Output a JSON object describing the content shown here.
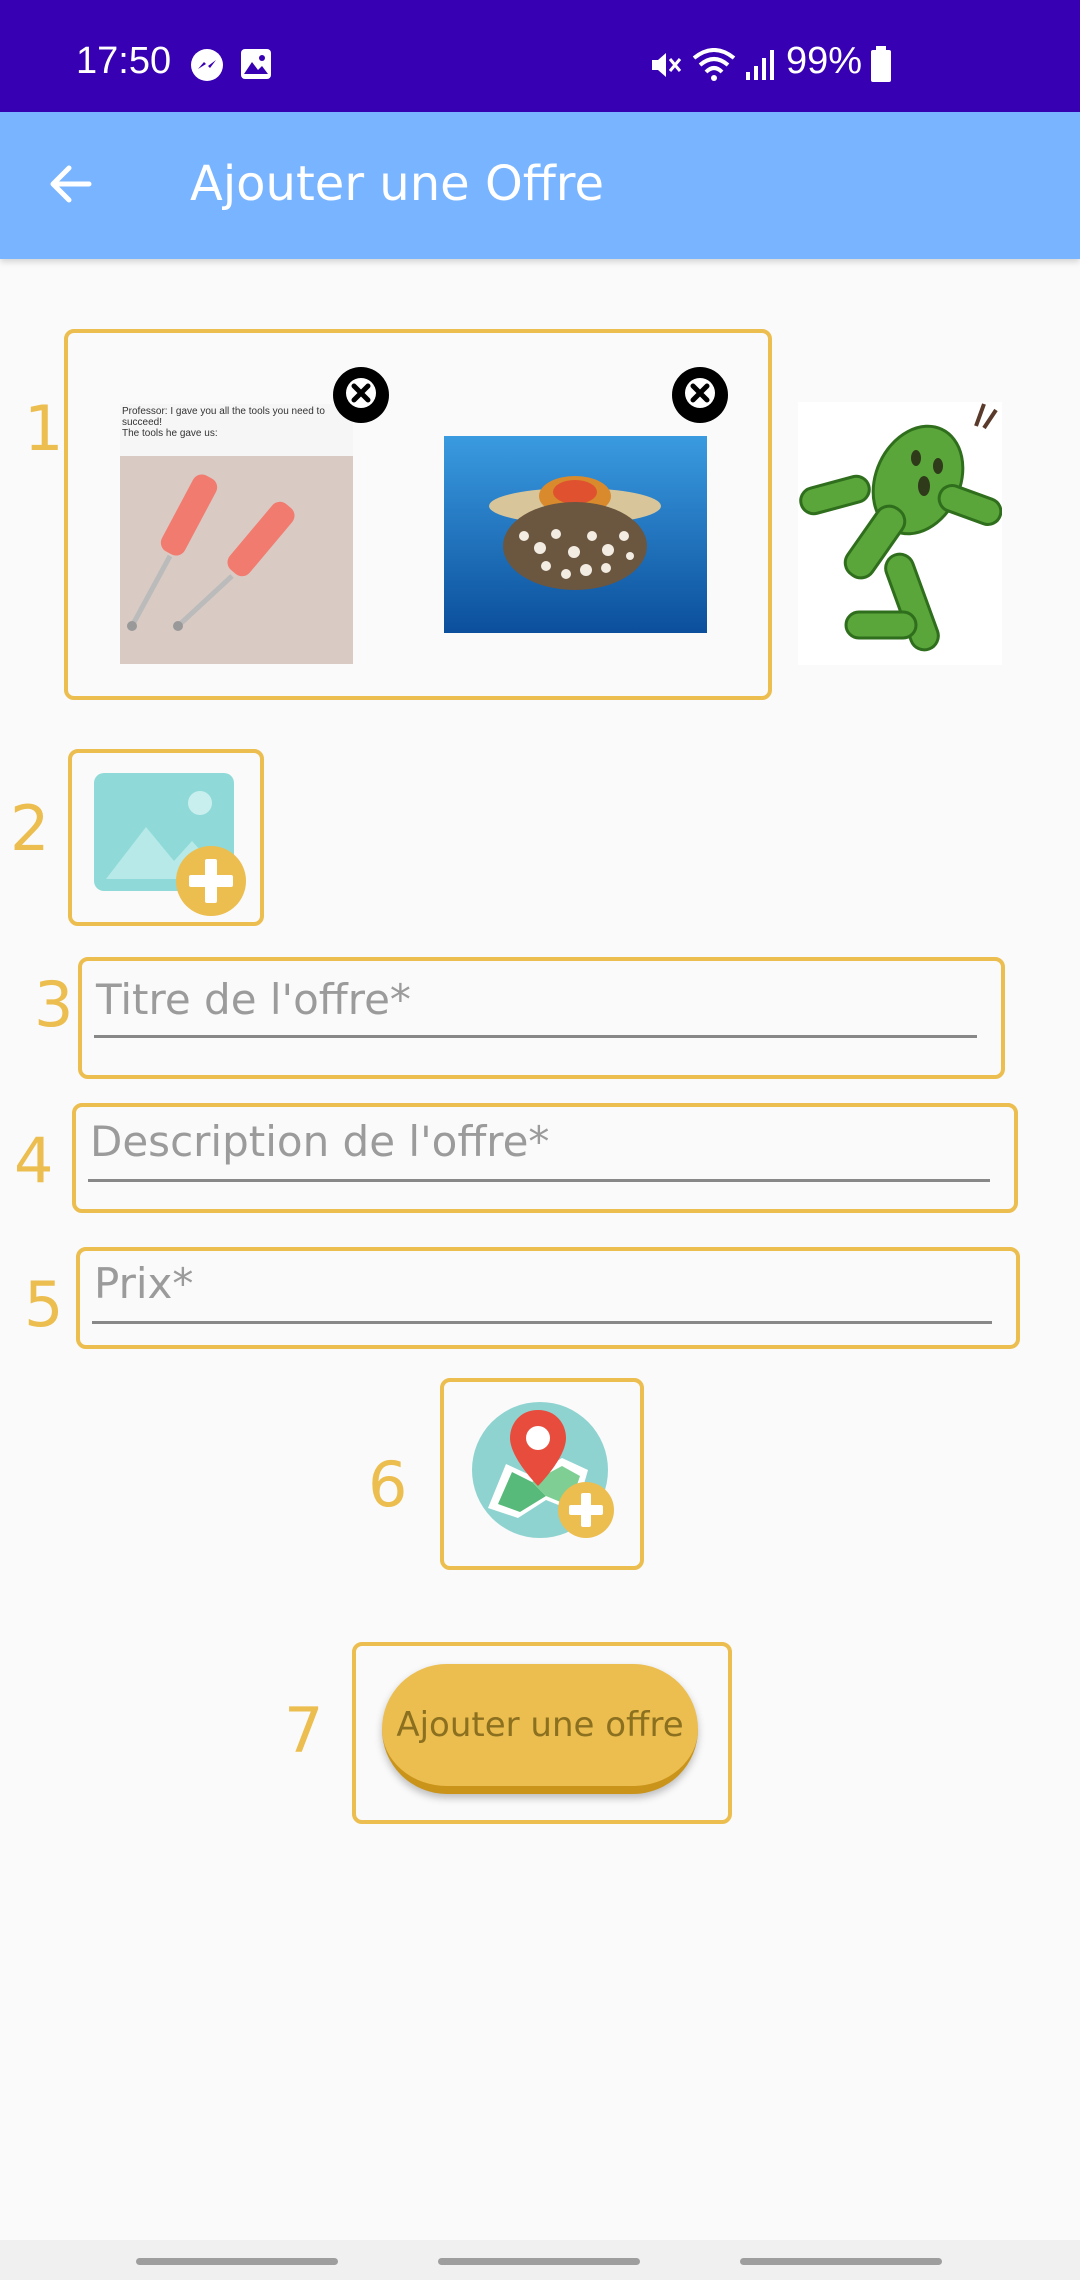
{
  "status": {
    "time": "17:50",
    "battery": "99%",
    "icons": [
      "messenger-icon",
      "gallery-icon",
      "mute-icon",
      "wifi-icon",
      "signal-icon",
      "battery-icon"
    ]
  },
  "app_bar": {
    "title": "Ajouter une Offre",
    "back_icon": "arrow-back-icon"
  },
  "sections": {
    "n1": "1",
    "n2": "2",
    "n3": "3",
    "n4": "4",
    "n5": "5",
    "n6": "6",
    "n7": "7"
  },
  "gallery": {
    "meme_line1": "Professor: I gave you all the tools you need to",
    "meme_line2": "succeed!",
    "meme_line3": "The tools he gave us:"
  },
  "form": {
    "title_placeholder": "Titre de l'offre*",
    "description_placeholder": "Description de l'offre*",
    "price_placeholder": "Prix*"
  },
  "submit": {
    "label": "Ajouter une offre"
  },
  "colors": {
    "status_bar": "#3700b3",
    "app_bar": "#78b4ff",
    "accent": "#ecbd4f"
  }
}
